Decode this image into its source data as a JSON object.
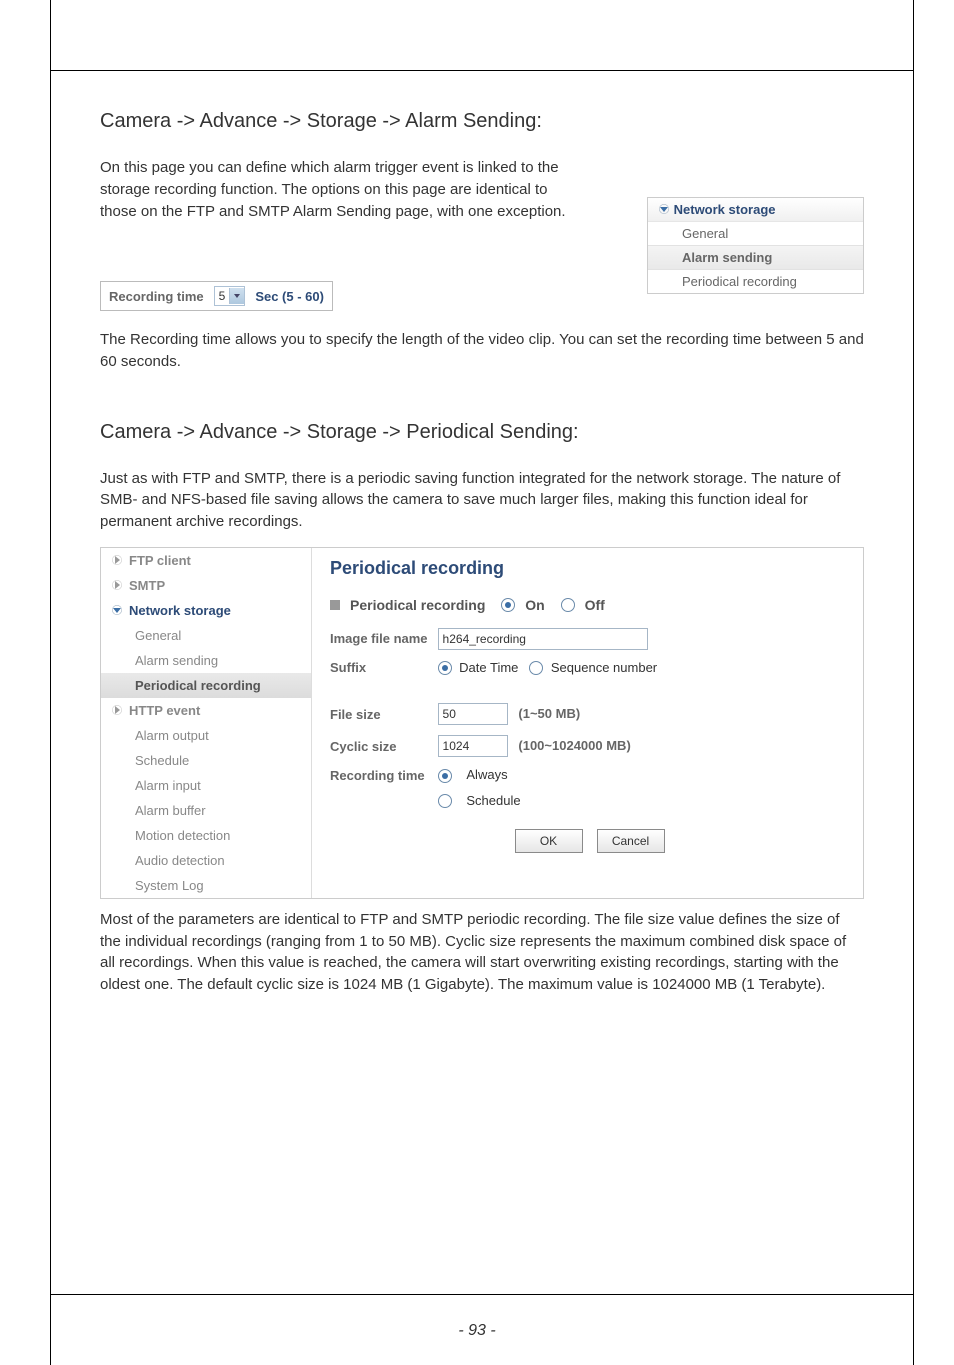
{
  "section1": {
    "heading": "Camera -> Advance -> Storage -> Alarm Sending:",
    "para": "On this page you can define which alarm trigger event is linked to the storage recording function. The options on this page are identical to those on the FTP and SMTP Alarm Sending page, with one exception.",
    "side_nav": {
      "header": "Network storage",
      "items": [
        "General",
        "Alarm sending",
        "Periodical recording"
      ],
      "selected_index": 1
    },
    "rt_box": {
      "label": "Recording time",
      "value": "5",
      "hint": "Sec (5 - 60)"
    },
    "para2": "The Recording time allows you to specify the length of the video clip. You can set the recording time between 5 and 60 seconds."
  },
  "section2": {
    "heading": "Camera -> Advance -> Storage -> Periodical Sending:",
    "para": "Just as with FTP and SMTP, there is a periodic saving function integrated for the network storage. The nature of SMB- and NFS-based file saving allows the camera to save much larger files, making this function ideal for permanent archive recordings.",
    "left_nav": [
      {
        "label": "FTP client",
        "type": "top"
      },
      {
        "label": "SMTP",
        "type": "top"
      },
      {
        "label": "Network storage",
        "type": "top_expanded"
      },
      {
        "label": "General",
        "type": "sub"
      },
      {
        "label": "Alarm sending",
        "type": "sub"
      },
      {
        "label": "Periodical recording",
        "type": "sub_selected"
      },
      {
        "label": "HTTP event",
        "type": "top"
      },
      {
        "label": "Alarm output",
        "type": "sub_plain"
      },
      {
        "label": "Schedule",
        "type": "sub_plain"
      },
      {
        "label": "Alarm input",
        "type": "sub_plain"
      },
      {
        "label": "Alarm buffer",
        "type": "sub_plain"
      },
      {
        "label": "Motion detection",
        "type": "sub_plain"
      },
      {
        "label": "Audio detection",
        "type": "sub_plain"
      },
      {
        "label": "System Log",
        "type": "sub_plain"
      }
    ],
    "form": {
      "title": "Periodical recording",
      "toggle": {
        "label": "Periodical recording",
        "options": [
          "On",
          "Off"
        ],
        "selected": "On"
      },
      "fields": {
        "image_file_name": {
          "label": "Image file name",
          "value": "h264_recording"
        },
        "suffix": {
          "label": "Suffix",
          "options": [
            "Date Time",
            "Sequence number"
          ],
          "selected": "Date Time"
        },
        "file_size": {
          "label": "File size",
          "value": "50",
          "unit": "(1~50 MB)"
        },
        "cyclic_size": {
          "label": "Cyclic size",
          "value": "1024",
          "unit": "(100~1024000 MB)"
        },
        "recording_time": {
          "label": "Recording time",
          "options": [
            "Always",
            "Schedule"
          ],
          "selected": "Always"
        }
      },
      "buttons": {
        "ok": "OK",
        "cancel": "Cancel"
      }
    },
    "para2": "Most of the parameters are identical to FTP and SMTP periodic recording. The file size value defines the size of the individual recordings (ranging from 1 to 50 MB). Cyclic size represents the maximum combined disk space of all recordings. When this value is reached, the camera will start overwriting existing recordings, starting with the oldest one. The default cyclic size is 1024 MB (1 Gigabyte). The maximum value is 1024000 MB (1 Terabyte)."
  },
  "page_number": "- 93 -"
}
